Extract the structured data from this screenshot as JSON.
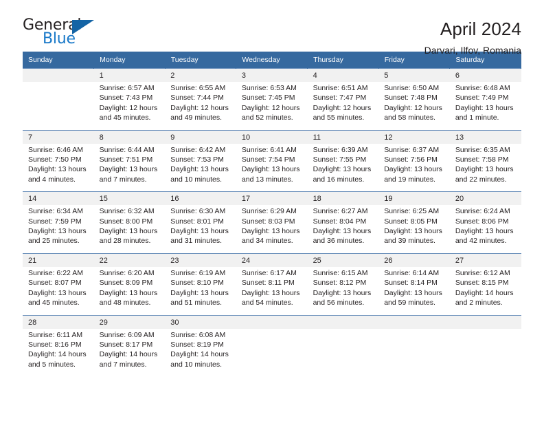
{
  "brand": {
    "name_part1": "General",
    "name_part2": "Blue",
    "triangle_color": "#1464a5",
    "blue_color": "#1878c8"
  },
  "header": {
    "title": "April 2024",
    "subtitle": "Darvari, Ilfov, Romania"
  },
  "theme": {
    "header_bg": "#36699f",
    "daynum_bg": "#f1f1f1",
    "cell_bg": "#ffffff",
    "text": "#231f20",
    "separator": "#6f93bd"
  },
  "weekdays": [
    "Sunday",
    "Monday",
    "Tuesday",
    "Wednesday",
    "Thursday",
    "Friday",
    "Saturday"
  ],
  "weeks": [
    [
      {
        "day": ""
      },
      {
        "day": "1",
        "sunrise": "Sunrise: 6:57 AM",
        "sunset": "Sunset: 7:43 PM",
        "daylight1": "Daylight: 12 hours",
        "daylight2": "and 45 minutes."
      },
      {
        "day": "2",
        "sunrise": "Sunrise: 6:55 AM",
        "sunset": "Sunset: 7:44 PM",
        "daylight1": "Daylight: 12 hours",
        "daylight2": "and 49 minutes."
      },
      {
        "day": "3",
        "sunrise": "Sunrise: 6:53 AM",
        "sunset": "Sunset: 7:45 PM",
        "daylight1": "Daylight: 12 hours",
        "daylight2": "and 52 minutes."
      },
      {
        "day": "4",
        "sunrise": "Sunrise: 6:51 AM",
        "sunset": "Sunset: 7:47 PM",
        "daylight1": "Daylight: 12 hours",
        "daylight2": "and 55 minutes."
      },
      {
        "day": "5",
        "sunrise": "Sunrise: 6:50 AM",
        "sunset": "Sunset: 7:48 PM",
        "daylight1": "Daylight: 12 hours",
        "daylight2": "and 58 minutes."
      },
      {
        "day": "6",
        "sunrise": "Sunrise: 6:48 AM",
        "sunset": "Sunset: 7:49 PM",
        "daylight1": "Daylight: 13 hours",
        "daylight2": "and 1 minute."
      }
    ],
    [
      {
        "day": "7",
        "sunrise": "Sunrise: 6:46 AM",
        "sunset": "Sunset: 7:50 PM",
        "daylight1": "Daylight: 13 hours",
        "daylight2": "and 4 minutes."
      },
      {
        "day": "8",
        "sunrise": "Sunrise: 6:44 AM",
        "sunset": "Sunset: 7:51 PM",
        "daylight1": "Daylight: 13 hours",
        "daylight2": "and 7 minutes."
      },
      {
        "day": "9",
        "sunrise": "Sunrise: 6:42 AM",
        "sunset": "Sunset: 7:53 PM",
        "daylight1": "Daylight: 13 hours",
        "daylight2": "and 10 minutes."
      },
      {
        "day": "10",
        "sunrise": "Sunrise: 6:41 AM",
        "sunset": "Sunset: 7:54 PM",
        "daylight1": "Daylight: 13 hours",
        "daylight2": "and 13 minutes."
      },
      {
        "day": "11",
        "sunrise": "Sunrise: 6:39 AM",
        "sunset": "Sunset: 7:55 PM",
        "daylight1": "Daylight: 13 hours",
        "daylight2": "and 16 minutes."
      },
      {
        "day": "12",
        "sunrise": "Sunrise: 6:37 AM",
        "sunset": "Sunset: 7:56 PM",
        "daylight1": "Daylight: 13 hours",
        "daylight2": "and 19 minutes."
      },
      {
        "day": "13",
        "sunrise": "Sunrise: 6:35 AM",
        "sunset": "Sunset: 7:58 PM",
        "daylight1": "Daylight: 13 hours",
        "daylight2": "and 22 minutes."
      }
    ],
    [
      {
        "day": "14",
        "sunrise": "Sunrise: 6:34 AM",
        "sunset": "Sunset: 7:59 PM",
        "daylight1": "Daylight: 13 hours",
        "daylight2": "and 25 minutes."
      },
      {
        "day": "15",
        "sunrise": "Sunrise: 6:32 AM",
        "sunset": "Sunset: 8:00 PM",
        "daylight1": "Daylight: 13 hours",
        "daylight2": "and 28 minutes."
      },
      {
        "day": "16",
        "sunrise": "Sunrise: 6:30 AM",
        "sunset": "Sunset: 8:01 PM",
        "daylight1": "Daylight: 13 hours",
        "daylight2": "and 31 minutes."
      },
      {
        "day": "17",
        "sunrise": "Sunrise: 6:29 AM",
        "sunset": "Sunset: 8:03 PM",
        "daylight1": "Daylight: 13 hours",
        "daylight2": "and 34 minutes."
      },
      {
        "day": "18",
        "sunrise": "Sunrise: 6:27 AM",
        "sunset": "Sunset: 8:04 PM",
        "daylight1": "Daylight: 13 hours",
        "daylight2": "and 36 minutes."
      },
      {
        "day": "19",
        "sunrise": "Sunrise: 6:25 AM",
        "sunset": "Sunset: 8:05 PM",
        "daylight1": "Daylight: 13 hours",
        "daylight2": "and 39 minutes."
      },
      {
        "day": "20",
        "sunrise": "Sunrise: 6:24 AM",
        "sunset": "Sunset: 8:06 PM",
        "daylight1": "Daylight: 13 hours",
        "daylight2": "and 42 minutes."
      }
    ],
    [
      {
        "day": "21",
        "sunrise": "Sunrise: 6:22 AM",
        "sunset": "Sunset: 8:07 PM",
        "daylight1": "Daylight: 13 hours",
        "daylight2": "and 45 minutes."
      },
      {
        "day": "22",
        "sunrise": "Sunrise: 6:20 AM",
        "sunset": "Sunset: 8:09 PM",
        "daylight1": "Daylight: 13 hours",
        "daylight2": "and 48 minutes."
      },
      {
        "day": "23",
        "sunrise": "Sunrise: 6:19 AM",
        "sunset": "Sunset: 8:10 PM",
        "daylight1": "Daylight: 13 hours",
        "daylight2": "and 51 minutes."
      },
      {
        "day": "24",
        "sunrise": "Sunrise: 6:17 AM",
        "sunset": "Sunset: 8:11 PM",
        "daylight1": "Daylight: 13 hours",
        "daylight2": "and 54 minutes."
      },
      {
        "day": "25",
        "sunrise": "Sunrise: 6:15 AM",
        "sunset": "Sunset: 8:12 PM",
        "daylight1": "Daylight: 13 hours",
        "daylight2": "and 56 minutes."
      },
      {
        "day": "26",
        "sunrise": "Sunrise: 6:14 AM",
        "sunset": "Sunset: 8:14 PM",
        "daylight1": "Daylight: 13 hours",
        "daylight2": "and 59 minutes."
      },
      {
        "day": "27",
        "sunrise": "Sunrise: 6:12 AM",
        "sunset": "Sunset: 8:15 PM",
        "daylight1": "Daylight: 14 hours",
        "daylight2": "and 2 minutes."
      }
    ],
    [
      {
        "day": "28",
        "sunrise": "Sunrise: 6:11 AM",
        "sunset": "Sunset: 8:16 PM",
        "daylight1": "Daylight: 14 hours",
        "daylight2": "and 5 minutes."
      },
      {
        "day": "29",
        "sunrise": "Sunrise: 6:09 AM",
        "sunset": "Sunset: 8:17 PM",
        "daylight1": "Daylight: 14 hours",
        "daylight2": "and 7 minutes."
      },
      {
        "day": "30",
        "sunrise": "Sunrise: 6:08 AM",
        "sunset": "Sunset: 8:19 PM",
        "daylight1": "Daylight: 14 hours",
        "daylight2": "and 10 minutes."
      },
      {
        "day": ""
      },
      {
        "day": ""
      },
      {
        "day": ""
      },
      {
        "day": ""
      }
    ]
  ]
}
